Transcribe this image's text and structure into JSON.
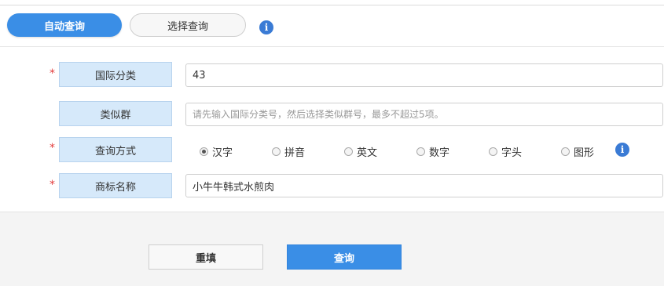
{
  "tabs": [
    {
      "label": "自动查询",
      "active": true
    },
    {
      "label": "选择查询",
      "active": false
    }
  ],
  "info_icon_glyph": "i",
  "form": {
    "required_mark": "*",
    "intl_class": {
      "label": "国际分类",
      "value": "43",
      "required": true
    },
    "similar_group": {
      "label": "类似群",
      "value": "",
      "placeholder": "请先输入国际分类号，然后选择类似群号，最多不超过5项。",
      "required": false
    },
    "query_mode": {
      "label": "查询方式",
      "required": true,
      "options": [
        {
          "label": "汉字",
          "checked": true
        },
        {
          "label": "拼音",
          "checked": false
        },
        {
          "label": "英文",
          "checked": false
        },
        {
          "label": "数字",
          "checked": false
        },
        {
          "label": "字头",
          "checked": false
        },
        {
          "label": "图形",
          "checked": false
        }
      ]
    },
    "trademark_name": {
      "label": "商标名称",
      "value": "小牛牛韩式水煎肉",
      "required": true
    }
  },
  "buttons": {
    "reset": "重填",
    "query": "查询"
  },
  "colors": {
    "accent": "#3a8ee6",
    "label_bg": "#d6e9fa",
    "required": "#e23b3b",
    "info": "#3a7bd5"
  }
}
